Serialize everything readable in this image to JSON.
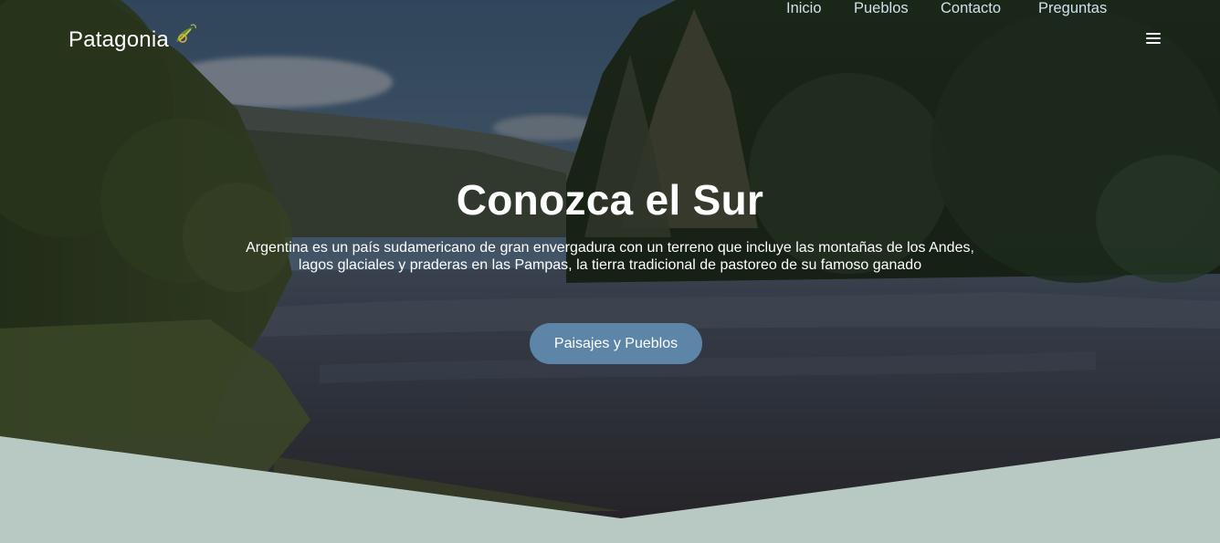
{
  "brand": {
    "name": "Patagonia",
    "logo_icon": "leaf-swirl-icon"
  },
  "nav": {
    "items": [
      {
        "label": "Inicio"
      },
      {
        "label": "Pueblos"
      },
      {
        "label": "Contacto"
      },
      {
        "label": "Preguntas"
      }
    ],
    "menu_icon": "hamburger-menu-icon"
  },
  "hero": {
    "title": "Conozca el Sur",
    "text": "Argentina es un país sudamericano de gran envergadura con un terreno que incluye las montañas de los Andes, lagos glaciales y praderas en las Pampas, la tierra tradicional de pastoreo de su famoso ganado",
    "button_label": "Paisajes y Pueblos"
  },
  "colors": {
    "button": "#5c85a7",
    "nav_link": "#cfe0ee",
    "section_bg": "#b8c8c2"
  }
}
